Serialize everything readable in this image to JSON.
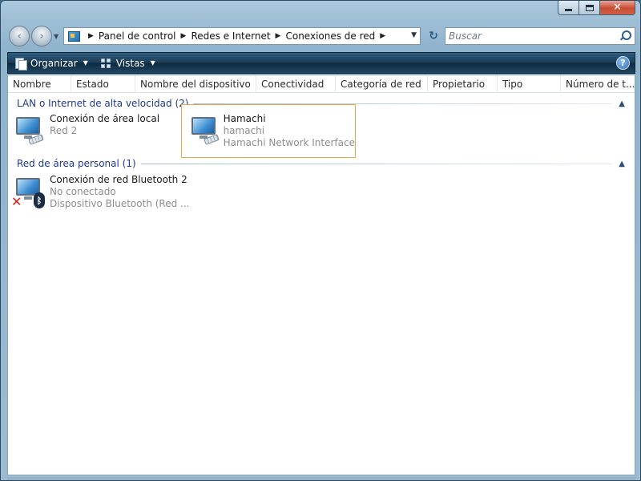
{
  "window": {
    "caption": {
      "minimize": "",
      "maximize": "",
      "close": "✕"
    }
  },
  "nav": {
    "back": "‹",
    "forward": "›",
    "breadcrumbs": [
      "Panel de control",
      "Redes e Internet",
      "Conexiones de red"
    ],
    "search_placeholder": "Buscar"
  },
  "toolbar": {
    "organize_label": "Organizar",
    "views_label": "Vistas",
    "help": "?"
  },
  "columns": [
    "Nombre",
    "Estado",
    "Nombre del dispositivo",
    "Conectividad",
    "Categoría de red",
    "Propietario",
    "Tipo",
    "Número de t..."
  ],
  "groups": [
    {
      "title": "LAN o Internet de alta velocidad (2)",
      "items": [
        {
          "name": "Conexión de área local",
          "line2": "Red  2",
          "line3": "",
          "icon": "network-monitor-icon",
          "selected": false
        },
        {
          "name": "Hamachi",
          "line2": "hamachi",
          "line3": "Hamachi Network Interface",
          "icon": "network-monitor-icon",
          "selected": true
        }
      ]
    },
    {
      "title": "Red de área personal (1)",
      "items": [
        {
          "name": "Conexión de red Bluetooth 2",
          "line2": "No conectado",
          "line3": "Dispositivo Bluetooth (Red ...",
          "icon": "bluetooth-network-icon",
          "selected": false
        }
      ]
    }
  ],
  "colors": {
    "group_title": "#1e3a8c",
    "selection_border": "#e6a84b",
    "subtext": "#8d8d8d"
  }
}
